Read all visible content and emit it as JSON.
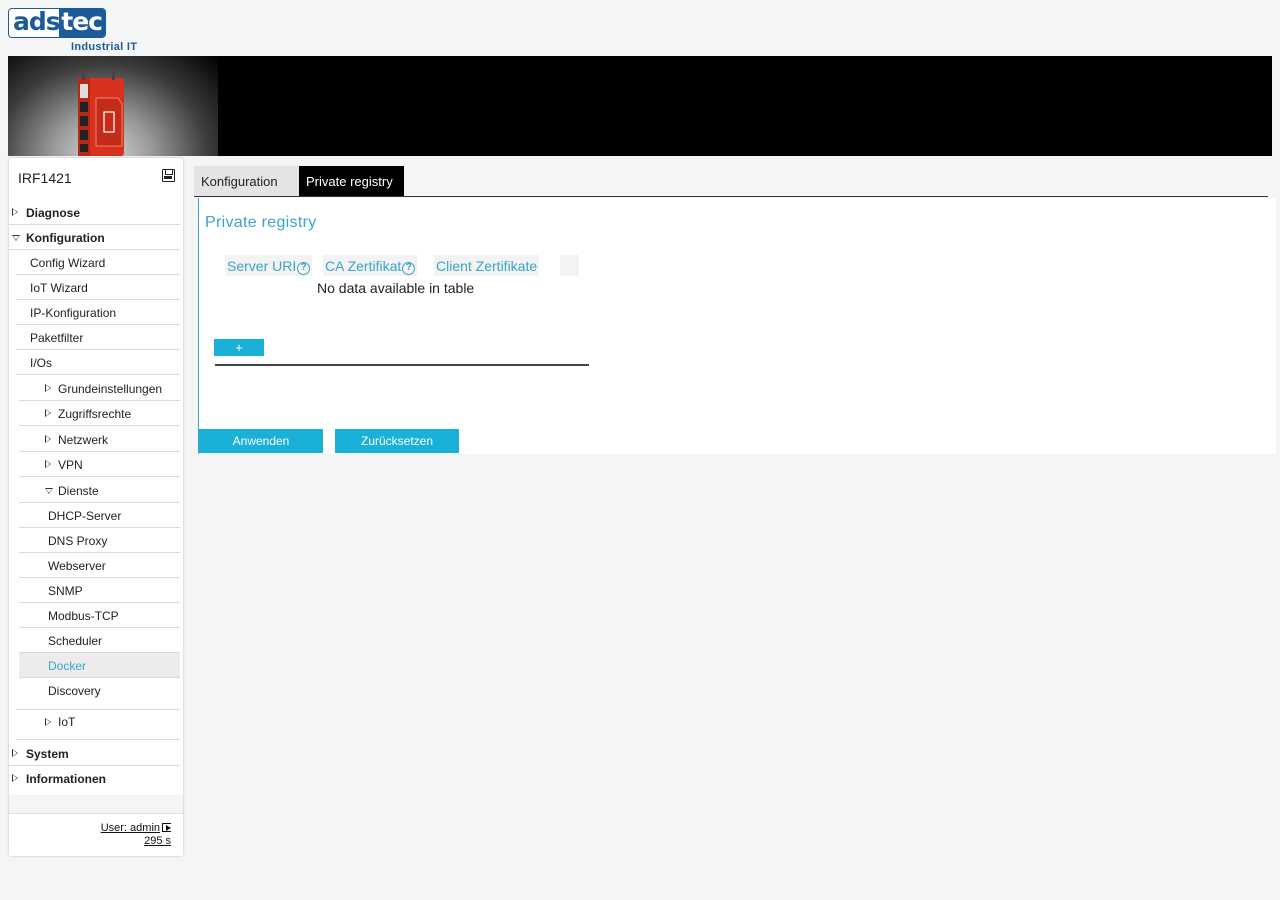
{
  "brand": {
    "logo_left": "ads",
    "logo_right": "tec",
    "tagline": "Industrial IT"
  },
  "sidebar": {
    "device_name": "IRF1421",
    "items": [
      {
        "label": "Diagnose"
      },
      {
        "label": "Konfiguration"
      },
      {
        "label": "Config Wizard"
      },
      {
        "label": "IoT Wizard"
      },
      {
        "label": "IP-Konfiguration"
      },
      {
        "label": "Paketfilter"
      },
      {
        "label": "I/Os"
      },
      {
        "label": "Grundeinstellungen"
      },
      {
        "label": "Zugriffsrechte"
      },
      {
        "label": "Netzwerk"
      },
      {
        "label": "VPN"
      },
      {
        "label": "Dienste"
      },
      {
        "label": "DHCP-Server"
      },
      {
        "label": "DNS Proxy"
      },
      {
        "label": "Webserver"
      },
      {
        "label": "SNMP"
      },
      {
        "label": "Modbus-TCP"
      },
      {
        "label": "Scheduler"
      },
      {
        "label": "Docker"
      },
      {
        "label": "Discovery"
      },
      {
        "label": "IoT"
      },
      {
        "label": "System"
      },
      {
        "label": "Informationen"
      }
    ],
    "active_item": "Docker",
    "user_link": "User: admin",
    "session_timer": "295 s"
  },
  "tabs": [
    {
      "label": "Konfiguration",
      "active": false
    },
    {
      "label": "Private registry",
      "active": true
    }
  ],
  "panel": {
    "title": "Private registry",
    "columns": [
      "Server URI",
      "CA Zertifikat",
      "Client Zertifikate"
    ],
    "empty_message": "No data available in table",
    "add_label": "+",
    "apply_label": "Anwenden",
    "reset_label": "Zurücksetzen"
  },
  "colors": {
    "accent": "#3aa5c6",
    "button": "#1ab0d8",
    "brand_blue": "#1b5b9a",
    "device_red": "#d8321f"
  }
}
